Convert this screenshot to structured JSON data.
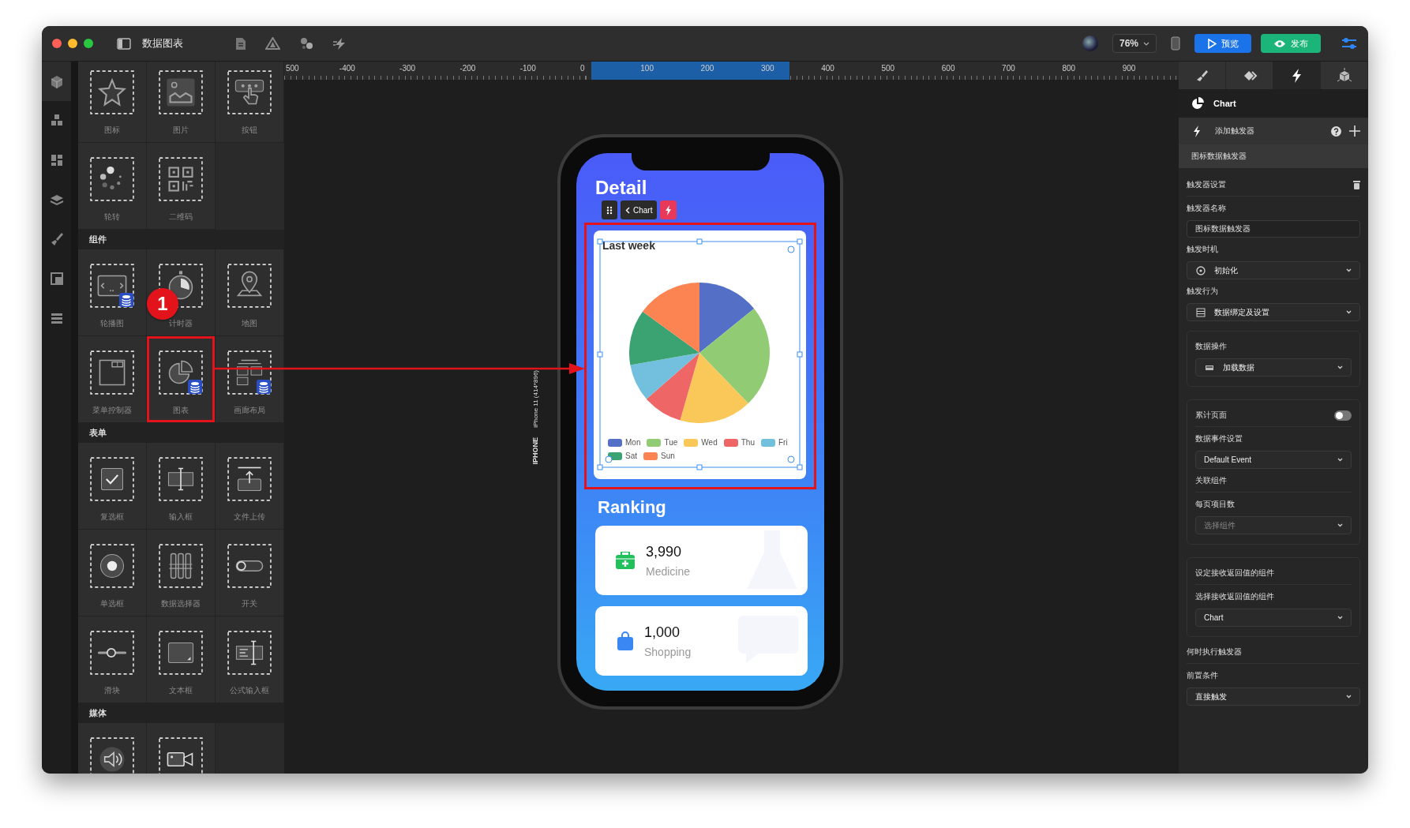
{
  "window": {
    "title": "数据图表"
  },
  "toolbar": {
    "zoom": "76%",
    "preview": "预览",
    "publish": "发布"
  },
  "rail": [
    {
      "selected": true
    },
    {
      "selected": false
    },
    {
      "selected": false
    },
    {
      "selected": false
    },
    {
      "selected": false
    },
    {
      "selected": false
    },
    {
      "selected": false
    }
  ],
  "widgets": {
    "sections": [
      {
        "items": [
          {
            "label": "图标",
            "kind": "star",
            "data_source": false,
            "highlighted": false
          },
          {
            "label": "图片",
            "kind": "image",
            "data_source": false,
            "highlighted": false
          },
          {
            "label": "按钮",
            "kind": "tap",
            "data_source": false,
            "highlighted": false
          },
          {
            "label": "轮转",
            "kind": "spinner",
            "data_source": false,
            "highlighted": false
          },
          {
            "label": "二维码",
            "kind": "qrcode",
            "data_source": false,
            "highlighted": false
          }
        ]
      },
      {
        "title": "组件",
        "items": [
          {
            "label": "轮播图",
            "kind": "carousel",
            "data_source": true,
            "highlighted": false
          },
          {
            "label": "计时器",
            "kind": "timer",
            "data_source": false,
            "highlighted": false
          },
          {
            "label": "地图",
            "kind": "map",
            "data_source": false,
            "highlighted": false
          },
          {
            "label": "菜单控制器",
            "kind": "menu",
            "data_source": false,
            "highlighted": false
          },
          {
            "label": "图表",
            "kind": "chart",
            "data_source": true,
            "highlighted": true
          },
          {
            "label": "画廊布局",
            "kind": "gallery",
            "data_source": true,
            "highlighted": false
          }
        ]
      },
      {
        "title": "表单",
        "items": [
          {
            "label": "复选框",
            "kind": "checkbox",
            "data_source": false,
            "highlighted": false
          },
          {
            "label": "输入框",
            "kind": "input",
            "data_source": false,
            "highlighted": false
          },
          {
            "label": "文件上传",
            "kind": "upload",
            "data_source": false,
            "highlighted": false
          },
          {
            "label": "单选框",
            "kind": "radio",
            "data_source": false,
            "highlighted": false
          },
          {
            "label": "数据选择器",
            "kind": "picker",
            "data_source": false,
            "highlighted": false
          },
          {
            "label": "开关",
            "kind": "switch",
            "data_source": false,
            "highlighted": false
          },
          {
            "label": "滑块",
            "kind": "slider",
            "data_source": false,
            "highlighted": false
          },
          {
            "label": "文本框",
            "kind": "textarea",
            "data_source": false,
            "highlighted": false
          },
          {
            "label": "公式输入框",
            "kind": "formula",
            "data_source": false,
            "highlighted": false
          }
        ]
      },
      {
        "title": "媒体",
        "items": [
          {
            "kind": "audio",
            "data_source": false,
            "highlighted": false
          },
          {
            "kind": "video",
            "data_source": false,
            "highlighted": false
          }
        ]
      }
    ]
  },
  "annotation": {
    "step": "1"
  },
  "ruler": {
    "labels": [
      {
        "text": "500",
        "selected": false
      },
      {
        "text": "-400",
        "selected": false
      },
      {
        "text": "-300",
        "selected": false
      },
      {
        "text": "-200",
        "selected": false
      },
      {
        "text": "-100",
        "selected": false
      },
      {
        "text": "0",
        "selected": false
      },
      {
        "text": "100",
        "selected": true
      },
      {
        "text": "200",
        "selected": true
      },
      {
        "text": "300",
        "selected": true
      },
      {
        "text": "400",
        "selected": false
      },
      {
        "text": "500",
        "selected": false
      },
      {
        "text": "600",
        "selected": false
      },
      {
        "text": "700",
        "selected": false
      },
      {
        "text": "800",
        "selected": false
      },
      {
        "text": "900",
        "selected": false
      }
    ]
  },
  "device": {
    "model": "iPhone 11 (414*896)",
    "family": "IPHONE"
  },
  "phone": {
    "title": "Detail",
    "selection_toolbar": {
      "label": "Chart"
    },
    "chart_card": {
      "highlighted": true,
      "title": "Last week",
      "legend": [
        {
          "name": "Mon",
          "color": "#5470c6"
        },
        {
          "name": "Tue",
          "color": "#91cc75"
        },
        {
          "name": "Wed",
          "color": "#fac858"
        },
        {
          "name": "Thu",
          "color": "#ee6666"
        },
        {
          "name": "Fri",
          "color": "#73c0de"
        },
        {
          "name": "Sat",
          "color": "#3ba272"
        },
        {
          "name": "Sun",
          "color": "#fc8452"
        }
      ]
    },
    "section_title": "Ranking",
    "cards": [
      {
        "kind": "medicine",
        "value": "3,990",
        "label": "Medicine"
      },
      {
        "kind": "shopping",
        "value": "1,000",
        "label": "Shopping"
      }
    ]
  },
  "inspector": {
    "tabs": [
      {
        "selected": false
      },
      {
        "selected": false
      },
      {
        "selected": true
      },
      {
        "selected": false
      }
    ],
    "component": "Chart",
    "add_trigger": "添加触发器",
    "triggers": [
      {
        "label": "图标数据触发器",
        "selected": true
      }
    ],
    "form": [
      {
        "kind": "heading",
        "text": "触发器设置",
        "deletable": true
      },
      {
        "kind": "label",
        "text": "触发器名称"
      },
      {
        "kind": "input",
        "value": "图标数据触发器"
      },
      {
        "kind": "label",
        "text": "触发时机"
      },
      {
        "kind": "select",
        "value": "初始化",
        "icon": true
      },
      {
        "kind": "label",
        "text": "触发行为"
      },
      {
        "kind": "select",
        "value": "数据绑定及设置",
        "icon": true
      },
      {
        "kind": "group",
        "items": [
          {
            "kind": "label",
            "text": "数据操作"
          },
          {
            "kind": "select",
            "value": "加载数据",
            "icon": true
          }
        ]
      },
      {
        "kind": "group",
        "items": [
          {
            "kind": "toggle",
            "text": "累计页面",
            "on": false
          },
          {
            "kind": "label",
            "text": "数据事件设置"
          },
          {
            "kind": "select",
            "value": "Default Event",
            "icon": false
          },
          {
            "kind": "heading",
            "text": "关联组件",
            "deletable": false
          },
          {
            "kind": "label",
            "text": "每页项目数"
          },
          {
            "kind": "select",
            "placeholder": "选择组件",
            "icon": false
          }
        ]
      },
      {
        "kind": "group",
        "items": [
          {
            "kind": "heading",
            "text": "设定接收返回值的组件",
            "deletable": false
          },
          {
            "kind": "label",
            "text": "选择接收返回值的组件"
          },
          {
            "kind": "select",
            "value": "Chart",
            "icon": false
          }
        ]
      },
      {
        "kind": "heading",
        "text": "何时执行触发器",
        "deletable": false
      },
      {
        "kind": "label",
        "text": "前置条件"
      },
      {
        "kind": "select",
        "value": "直接触发",
        "icon": false
      }
    ]
  }
}
